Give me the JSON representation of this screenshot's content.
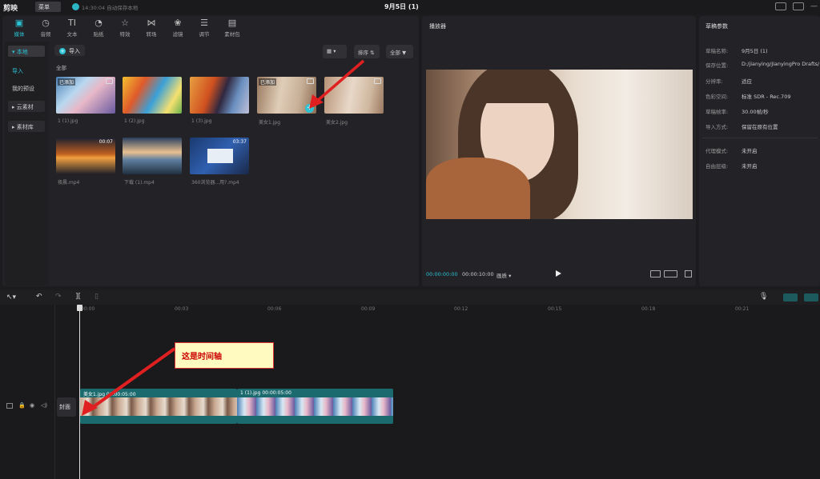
{
  "app": {
    "name": "剪映",
    "menu": "菜单",
    "save_status": "14:30:04 自动保存本地",
    "project_title": "9月5日 (1)"
  },
  "toolbar": {
    "tabs": [
      {
        "label": "媒体",
        "icon": "media-icon"
      },
      {
        "label": "音频",
        "icon": "audio-icon"
      },
      {
        "label": "文本",
        "icon": "text-icon"
      },
      {
        "label": "贴纸",
        "icon": "sticker-icon"
      },
      {
        "label": "特效",
        "icon": "effects-icon"
      },
      {
        "label": "转场",
        "icon": "transition-icon"
      },
      {
        "label": "滤镜",
        "icon": "filter-icon"
      },
      {
        "label": "调节",
        "icon": "adjust-icon"
      },
      {
        "label": "素材包",
        "icon": "package-icon"
      }
    ]
  },
  "sidebar": {
    "items": [
      {
        "label": "▾ 本地"
      },
      {
        "label": "导入"
      },
      {
        "label": "我的预设"
      },
      {
        "label": "▸ 云素材"
      },
      {
        "label": "▸ 素材库"
      }
    ]
  },
  "media": {
    "import_label": "导入",
    "sort_label": "排序",
    "filter_label": "全部",
    "section_label": "全部",
    "added_badge": "已添加",
    "items": [
      {
        "name": "1 (1).jpg",
        "added": true
      },
      {
        "name": "1 (2).jpg"
      },
      {
        "name": "1 (3).jpg"
      },
      {
        "name": "美女1.jpg",
        "added": true
      },
      {
        "name": "美女2.jpg"
      },
      {
        "name": "夜晨.mp4",
        "duration": "00:07"
      },
      {
        "name": "下载 (1).mp4"
      },
      {
        "name": "360浏览器...用?.mp4",
        "duration": "03:37"
      }
    ]
  },
  "player": {
    "title": "播放器",
    "current_time": "00:00:00:00",
    "total_time": "00:00:10:00",
    "quality": "画质 ▾"
  },
  "props": {
    "title": "草稿参数",
    "rows": [
      {
        "label": "草稿名称:",
        "value": "9月5日 (1)"
      },
      {
        "label": "保存位置:",
        "value": "D:/jianying/JianyingPro Drafts/"
      },
      {
        "label": "分辨率:",
        "value": "适应"
      },
      {
        "label": "色彩空间:",
        "value": "标准 SDR - Rec.709"
      },
      {
        "label": "草稿帧率:",
        "value": "30.00帧/秒"
      },
      {
        "label": "导入方式:",
        "value": "保留在原有位置"
      },
      {
        "label": "代理模式:",
        "value": "未开启"
      },
      {
        "label": "自由层级:",
        "value": "未开启"
      }
    ]
  },
  "timeline": {
    "ticks": [
      "00:00",
      "00:03",
      "00:06",
      "00:09",
      "00:12",
      "00:15",
      "00:18",
      "00:21"
    ],
    "cover_label": "封面",
    "clips": [
      {
        "label": "美女1.jpg  00:00:05:00"
      },
      {
        "label": "1 (1).jpg  00:00:05:00"
      }
    ]
  },
  "annotation": {
    "text": "这是时间轴"
  },
  "colors": {
    "accent": "#2bc2d4",
    "clip": "#1a6a6e",
    "arrow": "#e02020"
  }
}
